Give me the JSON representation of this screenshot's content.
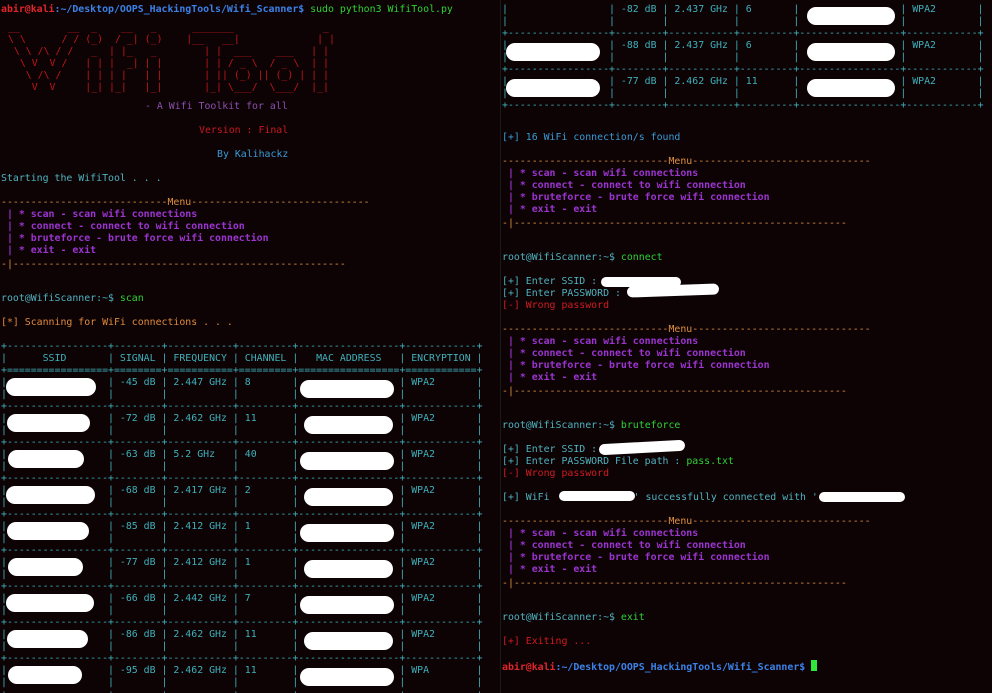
{
  "left_pane": {
    "prompt": {
      "user_host": "abir@kali",
      "path": ":~/Desktop/OOPS_HackingTools/Wifi_Scanner$",
      "command": "sudo python3 WifiTool.py"
    },
    "banner_art": [
      " __        __  _    __   _      _______               _ ",
      " \\ \\      / / (_)  / _| (_)    |__   __|             | |",
      "  \\ \\ /\\ / /   _  | |_   _        | |  ___    ___   | |",
      "   \\ V  V /   | | |  _| | |       | | / _ \\  / _ \\  | |",
      "    \\ /\\ /    | | | |   | |       | || (_) || (_) | | |",
      "     V  V     |_| |_|   |_|       |_| \\___/  \\___/  |_|"
    ],
    "tagline": "- A Wifi Toolkit for all",
    "version": "Version : Final",
    "author": "By Kalihackz",
    "starting": "Starting the WifiTool . . .",
    "menu": {
      "title": "Menu",
      "items": [
        "* scan - scan wifi connections",
        "* connect - connect to wifi connection",
        "* bruteforce - brute force wifi connection",
        "* exit - exit"
      ]
    },
    "scan_prompt": {
      "prompt": "root@WifiScanner:~$",
      "command": "scan"
    },
    "scanning": "[*] Scanning for WiFi connections . . .",
    "table": {
      "headers": [
        "SSID",
        "SIGNAL",
        "FREQUENCY",
        "CHANNEL",
        "MAC ADDRESS",
        "ENCRYPTION"
      ],
      "rows": [
        {
          "ssid": "[redacted]",
          "signal": "-45 dB",
          "frequency": "2.447 GHz",
          "channel": "8",
          "mac": "[redacted]",
          "encryption": "WPA2"
        },
        {
          "ssid": "[redacted]",
          "signal": "-72 dB",
          "frequency": "2.462 GHz",
          "channel": "11",
          "mac": "[redacted]",
          "encryption": "WPA2"
        },
        {
          "ssid": "[redacted]",
          "signal": "-63 dB",
          "frequency": "5.2 GHz",
          "channel": "40",
          "mac": "[redacted]",
          "encryption": "WPA2"
        },
        {
          "ssid": "[redacted]",
          "signal": "-68 dB",
          "frequency": "2.417 GHz",
          "channel": "2",
          "mac": "[redacted]",
          "encryption": "WPA2"
        },
        {
          "ssid": "[redacted]",
          "signal": "-85 dB",
          "frequency": "2.412 GHz",
          "channel": "1",
          "mac": "[redacted]",
          "encryption": "WPA2"
        },
        {
          "ssid": "[redacted]",
          "signal": "-77 dB",
          "frequency": "2.412 GHz",
          "channel": "1",
          "mac": "[redacted]",
          "encryption": "WPA2"
        },
        {
          "ssid": "[redacted]",
          "signal": "-66 dB",
          "frequency": "2.442 GHz",
          "channel": "7",
          "mac": "[redacted]",
          "encryption": "WPA2"
        },
        {
          "ssid": "[redacted]",
          "signal": "-86 dB",
          "frequency": "2.462 GHz",
          "channel": "11",
          "mac": "[redacted]",
          "encryption": "WPA2"
        },
        {
          "ssid": "[redacted]",
          "signal": "-95 dB",
          "frequency": "2.462 GHz",
          "channel": "11",
          "mac": "[redacted]",
          "encryption": "WPA"
        }
      ]
    }
  },
  "right_pane": {
    "table_rows": [
      {
        "ssid": "",
        "signal": "-82 dB",
        "frequency": "2.437 GHz",
        "channel": "6",
        "mac": "[redacted]",
        "encryption": "WPA2"
      },
      {
        "ssid": "[redacted]",
        "signal": "-88 dB",
        "frequency": "2.437 GHz",
        "channel": "6",
        "mac": "[redacted]",
        "encryption": "WPA2"
      },
      {
        "ssid": "[redacted]",
        "signal": "-77 dB",
        "frequency": "2.462 GHz",
        "channel": "11",
        "mac": "[redacted]",
        "encryption": "WPA2"
      }
    ],
    "found": "[+] 16 WiFi connection/s found",
    "connect_prompt": {
      "prompt": "root@WifiScanner:~$",
      "command": "connect"
    },
    "connect_lines": {
      "ssid_label": "[+] Enter SSID :",
      "password_label": "[+] Enter PASSWORD :",
      "error": "[-] Wrong password"
    },
    "brute_prompt": {
      "prompt": "root@WifiScanner:~$",
      "command": "bruteforce"
    },
    "brute_lines": {
      "ssid_label": "[+] Enter SSID :",
      "file_label": "[+] Enter PASSWORD File path :",
      "file_value": "pass.txt",
      "error": "[-] Wrong password",
      "success_prefix": "[+] WiFi",
      "success_mid": "' successfully connected with '"
    },
    "exit_prompt": {
      "prompt": "root@WifiScanner:~$",
      "command": "exit"
    },
    "exiting": "[+] Exiting ...",
    "final_prompt": {
      "user_host": "abir@kali",
      "path": ":~/Desktop/OOPS_HackingTools/Wifi_Scanner$"
    }
  }
}
